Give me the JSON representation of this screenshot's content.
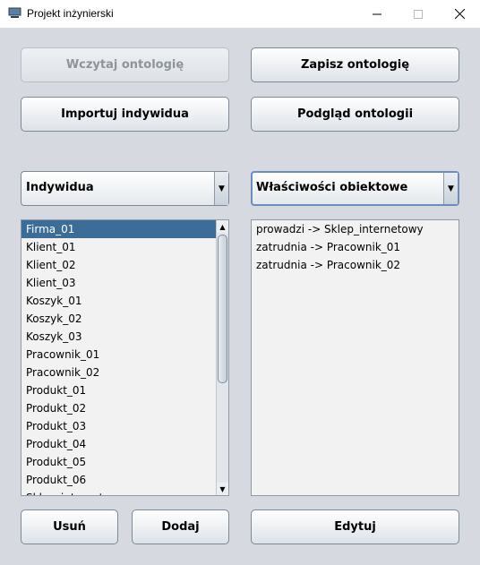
{
  "window": {
    "title": "Projekt inżynierski"
  },
  "buttons": {
    "load_ontology": "Wczytaj ontologię",
    "save_ontology": "Zapisz ontologię",
    "import_individuals": "Importuj indywidua",
    "preview_ontology": "Podgląd ontologii",
    "remove": "Usuń",
    "add": "Dodaj",
    "edit": "Edytuj"
  },
  "left_combo": {
    "value": "Indywidua"
  },
  "right_combo": {
    "value": "Właściwości obiektowe"
  },
  "individuals": [
    "Firma_01",
    "Klient_01",
    "Klient_02",
    "Klient_03",
    "Koszyk_01",
    "Koszyk_02",
    "Koszyk_03",
    "Pracownik_01",
    "Pracownik_02",
    "Produkt_01",
    "Produkt_02",
    "Produkt_03",
    "Produkt_04",
    "Produkt_05",
    "Produkt_06",
    "Sklep_internetowy"
  ],
  "selected_individual": "Firma_01",
  "properties": [
    "prowadzi -> Sklep_internetowy",
    "zatrudnia -> Pracownik_01",
    "zatrudnia -> Pracownik_02"
  ]
}
